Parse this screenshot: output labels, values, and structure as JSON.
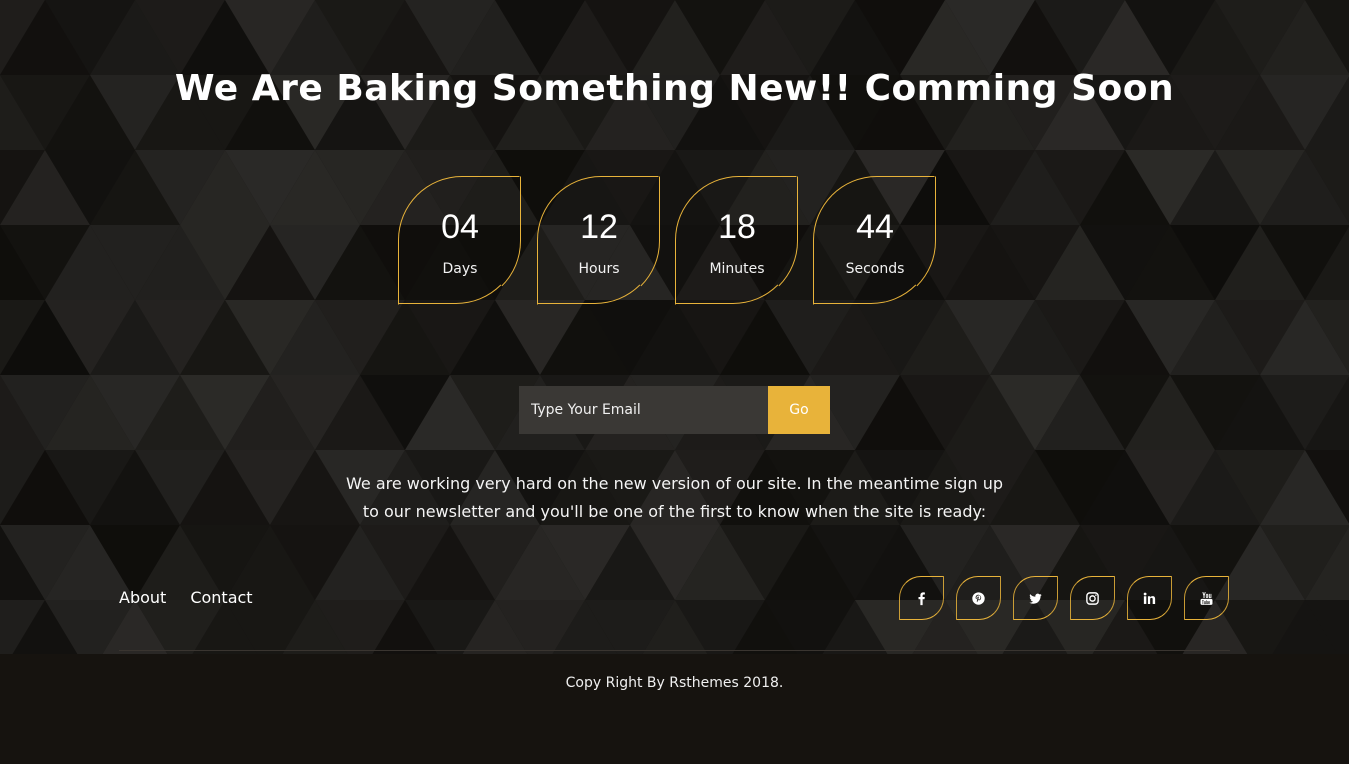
{
  "headline": "We Are Baking Something New!! Comming Soon",
  "countdown": [
    {
      "value": "04",
      "label": "Days"
    },
    {
      "value": "12",
      "label": "Hours"
    },
    {
      "value": "18",
      "label": "Minutes"
    },
    {
      "value": "44",
      "label": "Seconds"
    }
  ],
  "subscribe": {
    "placeholder": "Type Your Email",
    "button_label": "Go"
  },
  "message": "We are working very hard on the new version of our site. In the meantime sign up to our newsletter and you'll be one of the first to know when the site is ready:",
  "footer": {
    "links": [
      {
        "label": "About"
      },
      {
        "label": "Contact"
      }
    ],
    "social": [
      {
        "icon": "facebook-icon"
      },
      {
        "icon": "pinterest-icon"
      },
      {
        "icon": "twitter-icon"
      },
      {
        "icon": "instagram-icon"
      },
      {
        "icon": "linkedin-icon"
      },
      {
        "icon": "youtube-icon"
      }
    ],
    "copyright": "Copy Right By Rsthemes 2018."
  },
  "colors": {
    "accent": "#e8b33a",
    "background": "#1c1a18",
    "footer_bg": "#16130f",
    "input_bg": "#3a3835"
  }
}
